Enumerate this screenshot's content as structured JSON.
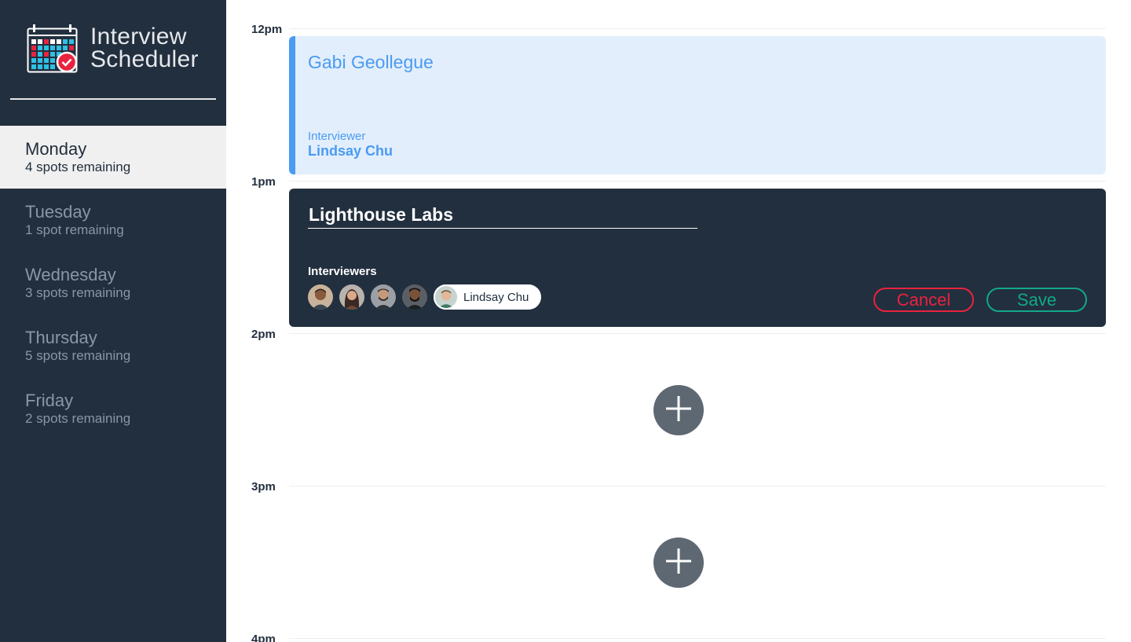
{
  "app": {
    "title_line1": "Interview",
    "title_line2": "Scheduler",
    "logo": "calendar-check-icon"
  },
  "sidebar": {
    "days": [
      {
        "name": "Monday",
        "spots": "4 spots remaining",
        "selected": true
      },
      {
        "name": "Tuesday",
        "spots": "1 spot remaining",
        "selected": false
      },
      {
        "name": "Wednesday",
        "spots": "3 spots remaining",
        "selected": false
      },
      {
        "name": "Thursday",
        "spots": "5 spots remaining",
        "selected": false
      },
      {
        "name": "Friday",
        "spots": "2 spots remaining",
        "selected": false
      }
    ]
  },
  "schedule": {
    "times": [
      "12pm",
      "1pm",
      "2pm",
      "3pm",
      "4pm"
    ],
    "show": {
      "student": "Gabi Geollegue",
      "interviewer_label": "Interviewer",
      "interviewer_name": "Lindsay Chu"
    },
    "form": {
      "student_value": "Lighthouse Labs",
      "interviewers_heading": "Interviewers",
      "selected_interviewer": "Lindsay Chu",
      "cancel_label": "Cancel",
      "save_label": "Save"
    },
    "empty_slot_icon": "plus-icon"
  },
  "colors": {
    "sidebar_bg": "#222f3e",
    "show_accent": "#4a9bf2",
    "show_bg": "#e2eefc",
    "cancel": "#e9233f",
    "save": "#12a886",
    "add_button": "#5e6872"
  }
}
